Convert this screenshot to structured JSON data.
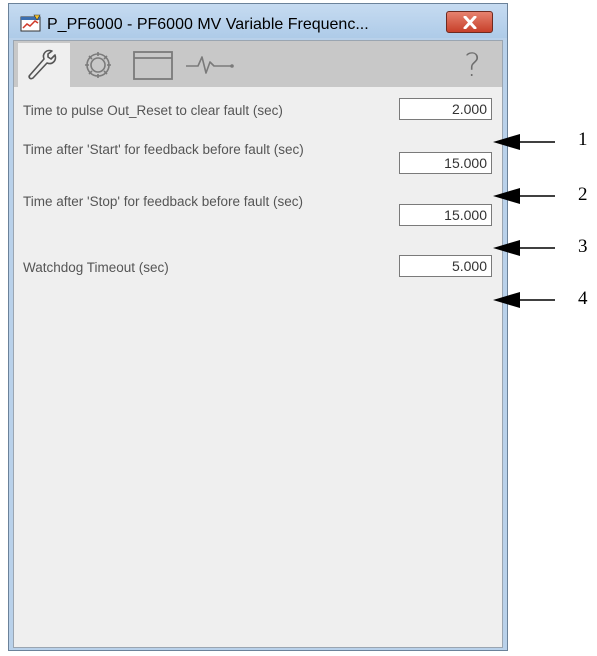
{
  "window": {
    "title": "P_PF6000 - PF6000 MV Variable Frequenc..."
  },
  "tabs": [
    {
      "icon": "wrench-icon",
      "active": true
    },
    {
      "icon": "gear-icon",
      "active": false
    },
    {
      "icon": "window-icon",
      "active": false
    },
    {
      "icon": "trend-icon",
      "active": false
    }
  ],
  "help_label": "?",
  "settings": [
    {
      "label": "Time to pulse Out_Reset to clear fault (sec)",
      "value": "2.000",
      "callout": "1"
    },
    {
      "label": "Time after 'Start' for feedback before fault (sec)",
      "value": "15.000",
      "callout": "2"
    },
    {
      "label": "Time after 'Stop' for feedback before fault (sec)",
      "value": "15.000",
      "callout": "3"
    },
    {
      "label": "Watchdog Timeout (sec)",
      "value": "5.000",
      "callout": "4"
    }
  ],
  "colors": {
    "frame": "#b9d1ea",
    "panel": "#efefef",
    "tabbar": "#c8c8c8",
    "close": "#c7402a"
  }
}
